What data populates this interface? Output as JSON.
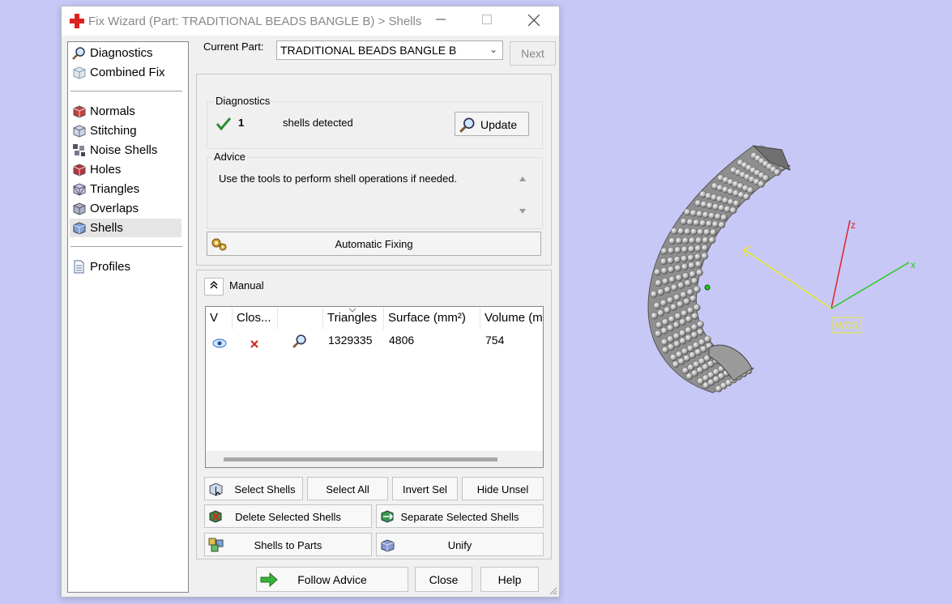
{
  "window": {
    "title": "Fix Wizard (Part: TRADITIONAL BEADS BANGLE B) > Shells",
    "icon": "red-cross-icon",
    "controls": [
      "minimize",
      "maximize",
      "close"
    ]
  },
  "nav": {
    "items": [
      {
        "label": "Diagnostics",
        "icon": "magnifier-icon"
      },
      {
        "label": "Combined Fix",
        "icon": "cube-icon"
      },
      {
        "label": "Normals",
        "icon": "normals-cube-icon"
      },
      {
        "label": "Stitching",
        "icon": "stitching-cube-icon"
      },
      {
        "label": "Noise Shells",
        "icon": "noise-shells-icon"
      },
      {
        "label": "Holes",
        "icon": "holes-cube-icon"
      },
      {
        "label": "Triangles",
        "icon": "triangles-cube-icon"
      },
      {
        "label": "Overlaps",
        "icon": "overlaps-cube-icon"
      },
      {
        "label": "Shells",
        "icon": "shells-cube-icon",
        "selected": true
      },
      {
        "label": "Profiles",
        "icon": "document-icon"
      }
    ]
  },
  "current_part": {
    "label": "Current Part:",
    "value": "TRADITIONAL BEADS BANGLE B"
  },
  "next_label": "Next",
  "diagnostics": {
    "title": "Diagnostics",
    "count": "1",
    "text": "shells detected",
    "update_label": "Update"
  },
  "advice": {
    "title": "Advice",
    "text": "Use the tools to perform shell operations if needed."
  },
  "automatic_fixing_label": "Automatic Fixing",
  "manual": {
    "label": "Manual",
    "columns": [
      "V",
      "Clos...",
      "",
      "Triangles",
      "Surface (mm²)",
      "Volume (m"
    ],
    "rows": [
      {
        "visible_icon": "eye-icon",
        "closed_icon": "red-x-icon",
        "zoom_icon": "magnifier-icon",
        "triangles": "1329335",
        "surface": "4806",
        "volume": "754"
      }
    ]
  },
  "buttons": {
    "select_shells": "Select Shells",
    "select_all": "Select All",
    "invert_sel": "Invert Sel",
    "hide_unsel": "Hide Unsel",
    "delete_selected": "Delete Selected Shells",
    "separate_selected": "Separate Selected Shells",
    "shells_to_parts": "Shells to Parts",
    "unify": "Unify",
    "follow_advice": "Follow Advice",
    "close": "Close",
    "help": "Help"
  },
  "viewport": {
    "background": "#c8c8f6",
    "axes": {
      "x": "x",
      "z": "z"
    },
    "wcs_label": "WCS",
    "axis_colors": {
      "x": "#22cc22",
      "y": "#e8e832",
      "z": "#dd2222"
    }
  }
}
